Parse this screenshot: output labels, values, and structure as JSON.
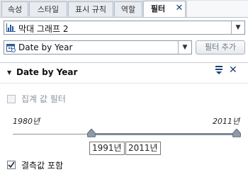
{
  "tabs": [
    {
      "label": "속성"
    },
    {
      "label": "스타일"
    },
    {
      "label": "표시 규칙"
    },
    {
      "label": "역할"
    },
    {
      "label": "필터"
    }
  ],
  "object_select": {
    "value": "막대 그래프 2"
  },
  "data_item_select": {
    "value": "Date by Year"
  },
  "add_filter_label": "필터 추가",
  "filter": {
    "title": "Date by Year",
    "aggregate_filter_label": "집계 값 필터",
    "aggregate_filter_checked": false,
    "range_min_label": "1980년",
    "range_max_label": "2011년",
    "range_start_value": "1991년",
    "range_end_value": "2011년",
    "include_missing_label": "결측값 포함",
    "include_missing_checked": true
  },
  "colors": {
    "accent": "#1c3f75",
    "border": "#8d97a3"
  },
  "icons": [
    "close-icon",
    "bar-chart-icon",
    "calendar-icon",
    "chevron-down-icon",
    "filter-menu-icon"
  ]
}
